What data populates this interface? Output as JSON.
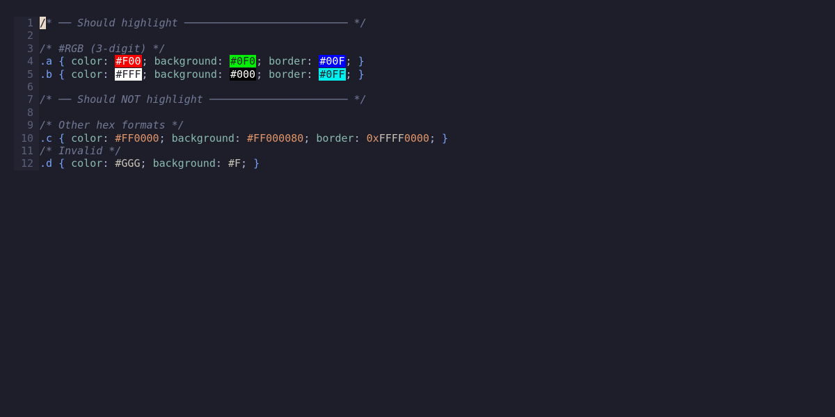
{
  "colors": {
    "background": "#1e1e2a",
    "gutter": "#232331",
    "comment": "#737a96",
    "selector": "#7aa2f7",
    "property": "#8ab9b0",
    "number": "#e0956a"
  },
  "lines": [
    {
      "n": "1",
      "tokens": [
        {
          "t": "/",
          "c": "cursor"
        },
        {
          "t": "* ── Should highlight ────────────────────────── */",
          "c": "cm"
        }
      ]
    },
    {
      "n": "2",
      "tokens": []
    },
    {
      "n": "3",
      "tokens": [
        {
          "t": "/* #RGB (3-digit) */",
          "c": "cm"
        }
      ]
    },
    {
      "n": "4",
      "tokens": [
        {
          "t": ".a",
          "c": "sel"
        },
        {
          "t": " ",
          "c": "punc"
        },
        {
          "t": "{",
          "c": "brace"
        },
        {
          "t": " color",
          "c": "prop"
        },
        {
          "t": ": ",
          "c": "punc"
        },
        {
          "t": "#F00",
          "c": "sw",
          "bg": "#ff0000",
          "fg": "#ffffff"
        },
        {
          "t": "; ",
          "c": "punc"
        },
        {
          "t": "background",
          "c": "prop"
        },
        {
          "t": ": ",
          "c": "punc"
        },
        {
          "t": "#0F0",
          "c": "sw",
          "bg": "#00ee00",
          "fg": "#1e1e2a"
        },
        {
          "t": "; ",
          "c": "punc"
        },
        {
          "t": "border",
          "c": "prop"
        },
        {
          "t": ": ",
          "c": "punc"
        },
        {
          "t": "#00F",
          "c": "sw",
          "bg": "#0000ff",
          "fg": "#ffffff"
        },
        {
          "t": "; ",
          "c": "punc"
        },
        {
          "t": "}",
          "c": "brace"
        }
      ]
    },
    {
      "n": "5",
      "tokens": [
        {
          "t": ".b",
          "c": "sel"
        },
        {
          "t": " ",
          "c": "punc"
        },
        {
          "t": "{",
          "c": "brace"
        },
        {
          "t": " color",
          "c": "prop"
        },
        {
          "t": ": ",
          "c": "punc"
        },
        {
          "t": "#FFF",
          "c": "sw",
          "bg": "#ffffff",
          "fg": "#1e1e2a"
        },
        {
          "t": "; ",
          "c": "punc"
        },
        {
          "t": "background",
          "c": "prop"
        },
        {
          "t": ": ",
          "c": "punc"
        },
        {
          "t": "#000",
          "c": "sw",
          "bg": "#000000",
          "fg": "#ffffff"
        },
        {
          "t": "; ",
          "c": "punc"
        },
        {
          "t": "border",
          "c": "prop"
        },
        {
          "t": ": ",
          "c": "punc"
        },
        {
          "t": "#0FF",
          "c": "sw",
          "bg": "#00f0f0",
          "fg": "#1e1e2a"
        },
        {
          "t": "; ",
          "c": "punc"
        },
        {
          "t": "}",
          "c": "brace"
        }
      ]
    },
    {
      "n": "6",
      "tokens": []
    },
    {
      "n": "7",
      "tokens": [
        {
          "t": "/* ── Should NOT highlight ────────────────────── */",
          "c": "cm"
        }
      ]
    },
    {
      "n": "8",
      "tokens": []
    },
    {
      "n": "9",
      "tokens": [
        {
          "t": "/* Other hex formats */",
          "c": "cm"
        }
      ]
    },
    {
      "n": "10",
      "tokens": [
        {
          "t": ".c",
          "c": "sel"
        },
        {
          "t": " ",
          "c": "punc"
        },
        {
          "t": "{",
          "c": "brace"
        },
        {
          "t": " color",
          "c": "prop"
        },
        {
          "t": ": ",
          "c": "punc"
        },
        {
          "t": "#FF0000",
          "c": "num"
        },
        {
          "t": "; ",
          "c": "punc"
        },
        {
          "t": "background",
          "c": "prop"
        },
        {
          "t": ": ",
          "c": "punc"
        },
        {
          "t": "#FF000080",
          "c": "num"
        },
        {
          "t": "; ",
          "c": "punc"
        },
        {
          "t": "border",
          "c": "prop"
        },
        {
          "t": ": ",
          "c": "punc"
        },
        {
          "t": "0x",
          "c": "num"
        },
        {
          "t": "FFFF",
          "c": "plain"
        },
        {
          "t": "0000",
          "c": "num"
        },
        {
          "t": "; ",
          "c": "punc"
        },
        {
          "t": "}",
          "c": "brace"
        }
      ]
    },
    {
      "n": "11",
      "tokens": [
        {
          "t": "/* Invalid */",
          "c": "cm"
        }
      ]
    },
    {
      "n": "12",
      "tokens": [
        {
          "t": ".d",
          "c": "sel"
        },
        {
          "t": " ",
          "c": "punc"
        },
        {
          "t": "{",
          "c": "brace"
        },
        {
          "t": " color",
          "c": "prop"
        },
        {
          "t": ": ",
          "c": "punc"
        },
        {
          "t": "#GGG",
          "c": "plain"
        },
        {
          "t": "; ",
          "c": "punc"
        },
        {
          "t": "background",
          "c": "prop"
        },
        {
          "t": ": ",
          "c": "punc"
        },
        {
          "t": "#F",
          "c": "plain"
        },
        {
          "t": "; ",
          "c": "punc"
        },
        {
          "t": "}",
          "c": "brace"
        }
      ]
    }
  ]
}
